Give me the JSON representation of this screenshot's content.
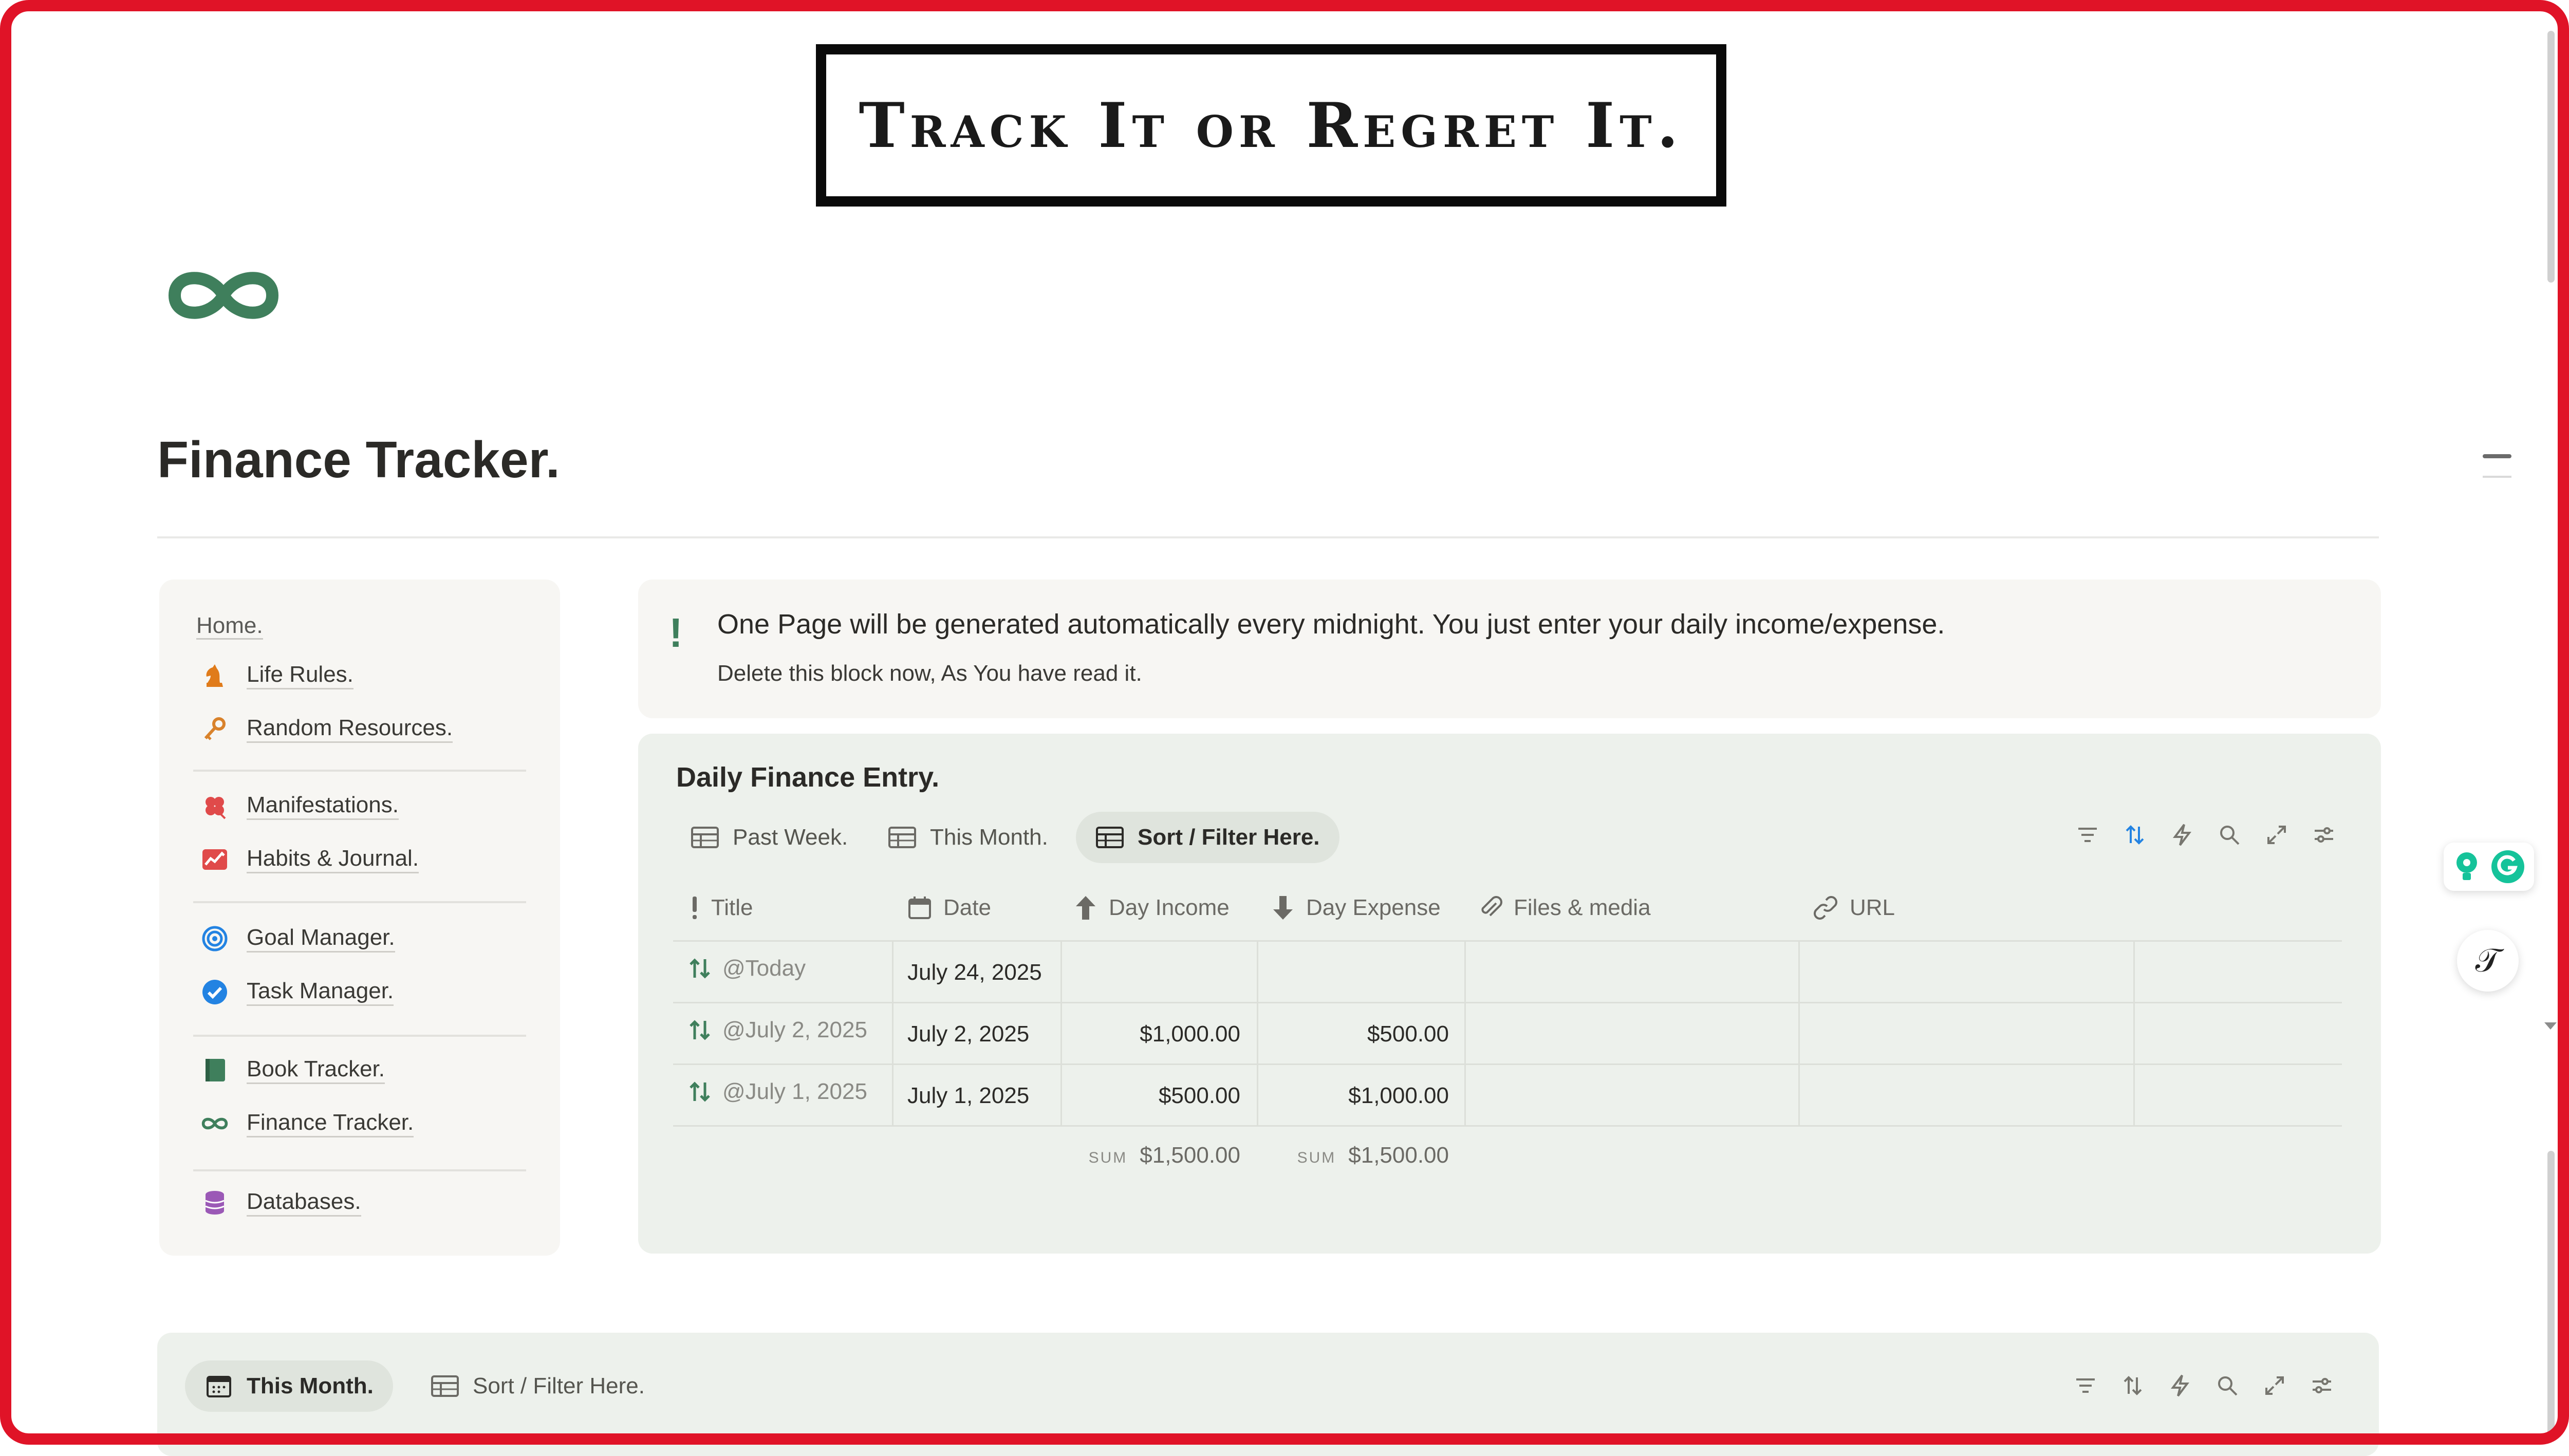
{
  "banner": {
    "text": "Track It or Regret It."
  },
  "page": {
    "title": "Finance Tracker."
  },
  "sidebar": {
    "home": "Home.",
    "items": [
      {
        "label": "Life Rules.",
        "icon": "chess-knight-icon"
      },
      {
        "label": "Random Resources.",
        "icon": "key-icon"
      },
      {
        "label": "Manifestations.",
        "icon": "clover-icon"
      },
      {
        "label": "Habits & Journal.",
        "icon": "chart-line-icon"
      },
      {
        "label": "Goal Manager.",
        "icon": "target-icon"
      },
      {
        "label": "Task Manager.",
        "icon": "check-circle-icon"
      },
      {
        "label": "Book Tracker.",
        "icon": "book-icon"
      },
      {
        "label": "Finance Tracker.",
        "icon": "infinity-icon"
      },
      {
        "label": "Databases.",
        "icon": "database-icon"
      }
    ]
  },
  "callout": {
    "icon": "!",
    "message": "One Page will be generated automatically every midnight. You just enter your daily income/expense.",
    "sub": "Delete this block now, As You have read it."
  },
  "database": {
    "title": "Daily Finance Entry.",
    "tabs": [
      "Past Week.",
      "This Month.",
      "Sort / Filter Here."
    ],
    "active_tab": "Sort / Filter Here.",
    "columns": [
      "Title",
      "Date",
      "Day Income",
      "Day Expense",
      "Files & media",
      "URL"
    ],
    "rows": [
      {
        "title": "@Today",
        "date": "July 24, 2025",
        "income": "",
        "expense": ""
      },
      {
        "title": "@July 2, 2025",
        "date": "July 2, 2025",
        "income": "$1,000.00",
        "expense": "$500.00"
      },
      {
        "title": "@July 1, 2025",
        "date": "July 1, 2025",
        "income": "$500.00",
        "expense": "$1,000.00"
      }
    ],
    "sum_label": "SUM",
    "income_sum": "$1,500.00",
    "expense_sum": "$1,500.00"
  },
  "database2": {
    "tabs": [
      "This Month.",
      "Sort / Filter Here."
    ],
    "active_tab": "This Month."
  },
  "colors": {
    "frame": "#e01327",
    "accent_green": "#3f7f5c",
    "block_bg": "#edf1ec",
    "sidebar_bg": "#f7f6f3",
    "sort_active": "#2383e2"
  }
}
